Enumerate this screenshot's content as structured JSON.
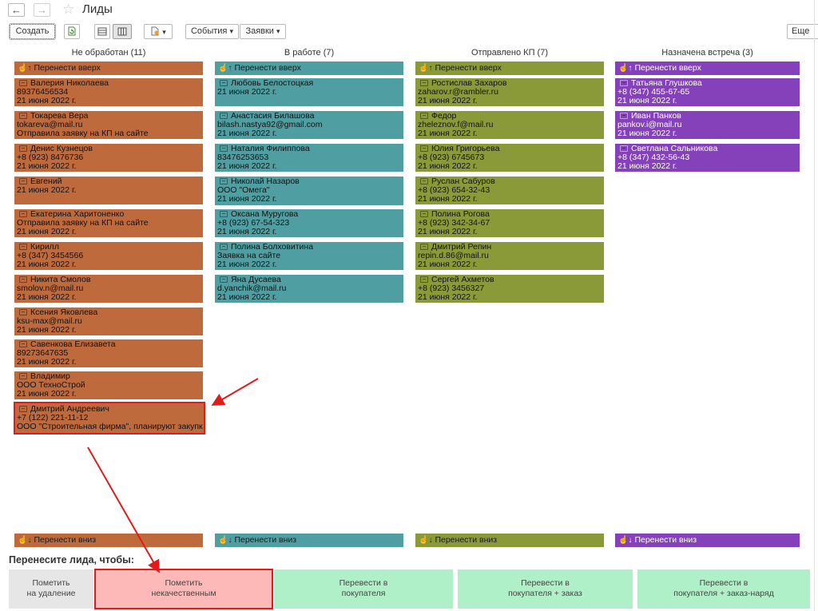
{
  "header": {
    "back_glyph": "←",
    "forward_glyph": "→",
    "star_glyph": "☆",
    "title": "Лиды"
  },
  "toolbar": {
    "create_label": "Создать",
    "events_label": "События",
    "requests_label": "Заявки",
    "more_label": "Еще",
    "dropdown_glyph": "▾"
  },
  "board": {
    "move_up_label": "Перенести вверх",
    "move_down_label": "Перенести вниз",
    "columns": [
      {
        "title": "Не обработан (11)",
        "color": "#bf6a3c",
        "cards": [
          {
            "name": "Валерия Николаева",
            "line2": "89376456534",
            "line3": "21 июня 2022 г."
          },
          {
            "name": "Токарева Вера",
            "line2": "tokareva@mail.ru",
            "line3": "Отправила заявку на КП на сайте"
          },
          {
            "name": "Денис Кузнецов",
            "line2": "+8 (923) 8476736",
            "line3": "21 июня 2022 г."
          },
          {
            "name": "Евгений",
            "line2": "21 июня 2022 г.",
            "line3": ""
          },
          {
            "name": "Екатерина Харитоненко",
            "line2": "Отправила заявку на КП на сайте",
            "line3": "21 июня 2022 г."
          },
          {
            "name": "Кирилл",
            "line2": "+8 (347) 3454566",
            "line3": "21 июня 2022 г."
          },
          {
            "name": "Никита Смолов",
            "line2": "smolov.n@mail.ru",
            "line3": "21 июня 2022 г."
          },
          {
            "name": "Ксения Яковлева",
            "line2": "ksu-max@mail.ru",
            "line3": "21 июня 2022 г."
          },
          {
            "name": "Савенкова Елизавета",
            "line2": "89273647635",
            "line3": "21 июня 2022 г."
          },
          {
            "name": "Владимир",
            "line2": "ООО ТехноСтрой",
            "line3": "21 июня 2022 г."
          },
          {
            "name": "Дмитрий Андреевич",
            "line2": "+7 (122) 221-11-12",
            "line3": "ООО \"Строительная фирма\", планируют закупк"
          }
        ]
      },
      {
        "title": "В работе (7)",
        "color": "#4f9fa2",
        "cards": [
          {
            "name": "Любовь Белостоцкая",
            "line2": "21 июня 2022 г.",
            "line3": ""
          },
          {
            "name": "Анастасия Билашова",
            "line2": "bilash.nastya92@gmail.com",
            "line3": "21 июня 2022 г."
          },
          {
            "name": "Наталия Филиппова",
            "line2": "83476253653",
            "line3": "21 июня 2022 г."
          },
          {
            "name": "Николай Назаров",
            "line2": "ООО \"Омега\"",
            "line3": "21 июня 2022 г."
          },
          {
            "name": "Оксана Муругова",
            "line2": "+8 (923) 67-54-323",
            "line3": "21 июня 2022 г."
          },
          {
            "name": "Полина Болховитина",
            "line2": "Заявка на сайте",
            "line3": "21 июня 2022 г."
          },
          {
            "name": "Яна Дусаева",
            "line2": "d.yanchik@mail.ru",
            "line3": "21 июня 2022 г."
          }
        ]
      },
      {
        "title": "Отправлено КП (7)",
        "color": "#8a9a38",
        "cards": [
          {
            "name": "Ростислав Захаров",
            "line2": "zaharov.r@rambler.ru",
            "line3": "21 июня 2022 г."
          },
          {
            "name": "Федор",
            "line2": "zheleznov.f@mail.ru",
            "line3": "21 июня 2022 г."
          },
          {
            "name": "Юлия Григорьева",
            "line2": "+8 (923) 6745673",
            "line3": "21 июня 2022 г."
          },
          {
            "name": "Руслан Сабуров",
            "line2": "+8 (923) 654-32-43",
            "line3": "21 июня 2022 г."
          },
          {
            "name": "Полина Рогова",
            "line2": "+8 (923) 342-34-67",
            "line3": "21 июня 2022 г."
          },
          {
            "name": "Дмитрий Репин",
            "line2": "repin.d.86@mail.ru",
            "line3": "21 июня 2022 г."
          },
          {
            "name": "Сергей Ахметов",
            "line2": "+8 (923) 3456327",
            "line3": "21 июня 2022 г."
          }
        ]
      },
      {
        "title": "Назначена встреча (3)",
        "color": "#8441b9",
        "cards": [
          {
            "name": "Татьяна Глушкова",
            "line2": "+8 (347) 455-67-65",
            "line3": "21 июня 2022 г."
          },
          {
            "name": "Иван Панков",
            "line2": "pankov.i@mail.ru",
            "line3": "21 июня 2022 г."
          },
          {
            "name": "Светлана Сальникова",
            "line2": "+8 (347) 432-56-43",
            "line3": "21 июня 2022 г."
          }
        ]
      }
    ]
  },
  "bottom": {
    "prompt": "Перенесите лида, чтобы:",
    "actions": [
      {
        "line1": "Пометить",
        "line2": "на удаление",
        "color": "#e6e6e6"
      },
      {
        "line1": "Пометить",
        "line2": "некачественным",
        "color": "#fdb8b8"
      },
      {
        "line1": "Перевести в",
        "line2": "покупателя",
        "color": "#b0f0c8"
      },
      {
        "line1": "Перевести в",
        "line2": "покупателя + заказ",
        "color": "#b0f0c8"
      },
      {
        "line1": "Перевести в",
        "line2": "покупателя + заказ-наряд",
        "color": "#b0f0c8"
      }
    ]
  },
  "accent_color": "#e01b1b"
}
